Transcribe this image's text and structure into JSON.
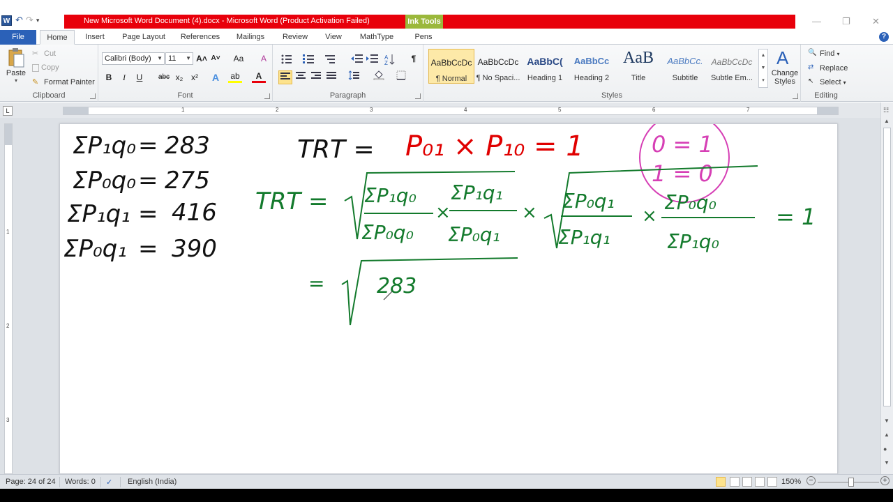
{
  "window": {
    "title": "New Microsoft Word Document (4).docx  -  Microsoft Word (Product Activation Failed)",
    "contextual_tab": "Ink Tools",
    "minimize": "—",
    "restore": "❐",
    "close": "✕"
  },
  "tabs": [
    "File",
    "Home",
    "Insert",
    "Page Layout",
    "References",
    "Mailings",
    "Review",
    "View",
    "MathType",
    "Pens"
  ],
  "help": "?",
  "clipboard": {
    "paste": "Paste",
    "cut": "Cut",
    "copy": "Copy",
    "format_painter": "Format Painter",
    "label": "Clipboard"
  },
  "font": {
    "family": "Calibri (Body)",
    "size": "11",
    "label": "Font",
    "bold": "B",
    "italic": "I",
    "underline": "U",
    "strike": "abc",
    "subscript": "x₂",
    "superscript": "x²",
    "grow": "A˄",
    "shrink": "A˅",
    "case": "Aa",
    "clear": "A",
    "effects": "A",
    "highlight": "ab",
    "color": "A"
  },
  "paragraph": {
    "label": "Paragraph",
    "pilcrow": "¶"
  },
  "styles": {
    "label": "Styles",
    "items": [
      {
        "sample": "AaBbCcDc",
        "name": "¶ Normal"
      },
      {
        "sample": "AaBbCcDc",
        "name": "¶ No Spaci..."
      },
      {
        "sample": "AaBbC(",
        "name": "Heading 1"
      },
      {
        "sample": "AaBbCc",
        "name": "Heading 2"
      },
      {
        "sample": "AaB",
        "name": "Title"
      },
      {
        "sample": "AaBbCc.",
        "name": "Subtitle"
      },
      {
        "sample": "AaBbCcDc",
        "name": "Subtle Em..."
      }
    ],
    "change_styles": "Change Styles"
  },
  "editing": {
    "label": "Editing",
    "find": "Find",
    "replace": "Replace",
    "select": "Select"
  },
  "ruler": {
    "numbers": [
      "1",
      "2",
      "3",
      "4",
      "5",
      "6",
      "7"
    ],
    "tab_selector": "L"
  },
  "vruler": {
    "numbers": [
      "1",
      "2",
      "3"
    ]
  },
  "status": {
    "page": "Page: 24 of 24",
    "words": "Words: 0",
    "language": "English (India)",
    "zoom": "150%",
    "zoom_out": "−",
    "zoom_in": "+"
  },
  "ink_notes": {
    "left": [
      {
        "lhs": "ΣP₁q₀",
        "value": "283"
      },
      {
        "lhs": "ΣP₀q₀",
        "value": "275"
      },
      {
        "lhs": "ΣP₁q₁",
        "value": "416"
      },
      {
        "lhs": "ΣP₀q₁",
        "value": "390"
      }
    ],
    "trt_line1": {
      "label": "TRT =",
      "expr": "P₀₁ × P₁₀ = 1"
    },
    "circle": {
      "line1": "0 = 1",
      "line2": "1 = 0"
    },
    "trt_line2": {
      "label": "TRT =",
      "f1_num": "ΣP₁q₀",
      "f1_den": "ΣP₀q₀",
      "f2_num": "ΣP₁q₁",
      "f2_den": "ΣP₀q₁",
      "f3_num": "ΣP₀q₁",
      "f3_den": "ΣP₁q₁",
      "f4_num": "ΣP₀q₀",
      "f4_den": "ΣP₁q₀",
      "times": "×",
      "result": "= 1"
    },
    "line3": {
      "eq": "=",
      "value": "283"
    }
  }
}
